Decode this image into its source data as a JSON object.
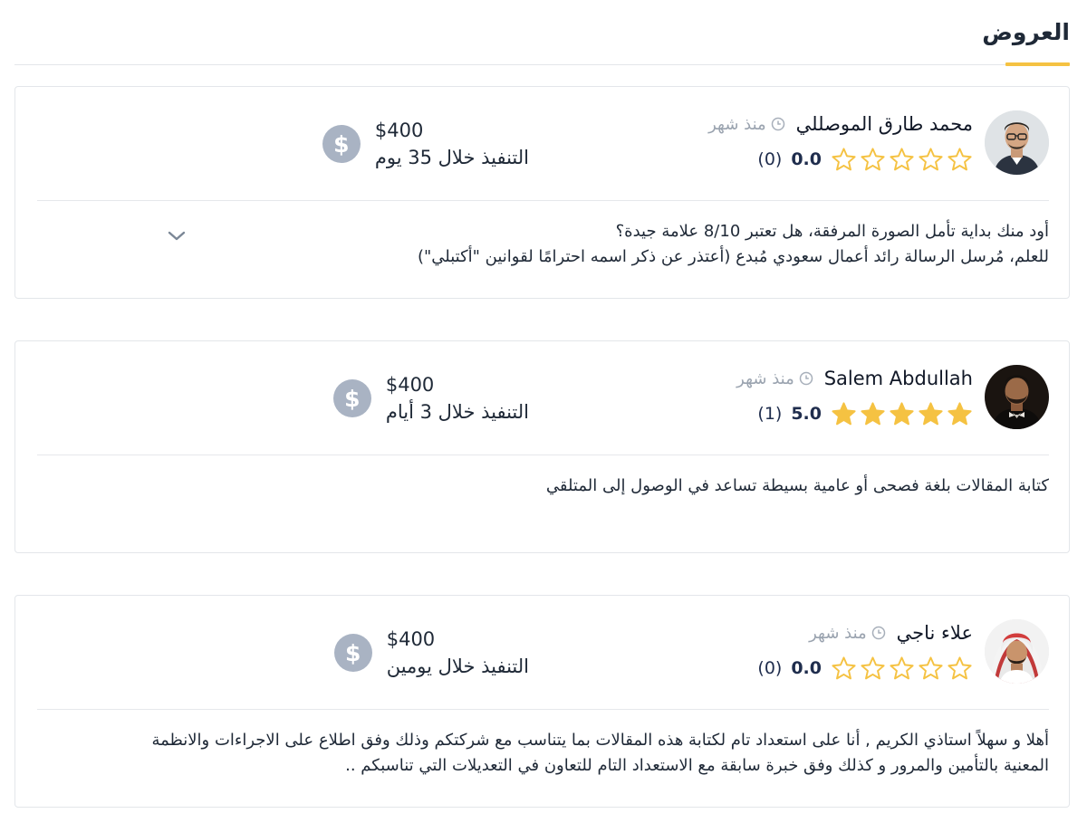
{
  "section": {
    "title": "العروض",
    "accent_color": "#f5c242"
  },
  "offers": [
    {
      "name": "محمد طارق الموصللي",
      "time_ago": "منذ شهر",
      "rating_value": "0.0",
      "rating_count": "(0)",
      "stars_filled": 0,
      "price": "$400",
      "delivery": "التنفيذ خلال 35 يوم",
      "body_lines": [
        "أود منك بداية تأمل الصورة المرفقة، هل تعتبر 8/10 علامة جيدة؟",
        "للعلم، مُرسل الرسالة رائد أعمال سعودي مُبدع (أعتذر عن ذكر اسمه احترامًا لقوانين \"أكتبلي\")"
      ],
      "has_expand_icon": true
    },
    {
      "name": "Salem Abdullah",
      "time_ago": "منذ شهر",
      "rating_value": "5.0",
      "rating_count": "(1)",
      "stars_filled": 5,
      "price": "$400",
      "delivery": "التنفيذ خلال 3 أيام",
      "body_lines": [
        "كتابة المقالات بلغة فصحى أو عامية بسيطة تساعد في الوصول إلى المتلقي"
      ],
      "has_expand_icon": false
    },
    {
      "name": "علاء ناجي",
      "time_ago": "منذ شهر",
      "rating_value": "0.0",
      "rating_count": "(0)",
      "stars_filled": 0,
      "price": "$400",
      "delivery": "التنفيذ خلال يومين",
      "body_lines": [
        "أهلا و سهلاً استاذي الكريم , أنا على استعداد تام لكتابة هذه المقالات بما يتناسب مع شركتكم وذلك وفق اطلاع على الاجراءات والانظمة",
        "المعنية بالتأمين والمرور و كذلك وفق خبرة سابقة مع الاستعداد التام للتعاون في التعديلات التي تناسبكم .."
      ],
      "has_expand_icon": false
    }
  ],
  "icons": {
    "clock": "clock-icon",
    "star": "star-icon",
    "dollar_symbol": "$",
    "expand": "chevron-down-icon"
  },
  "colors": {
    "star": "#f5c242",
    "dollar_badge": "#a9b3c3",
    "muted": "#9aa3af",
    "rating_text": "#1f2d4d"
  }
}
